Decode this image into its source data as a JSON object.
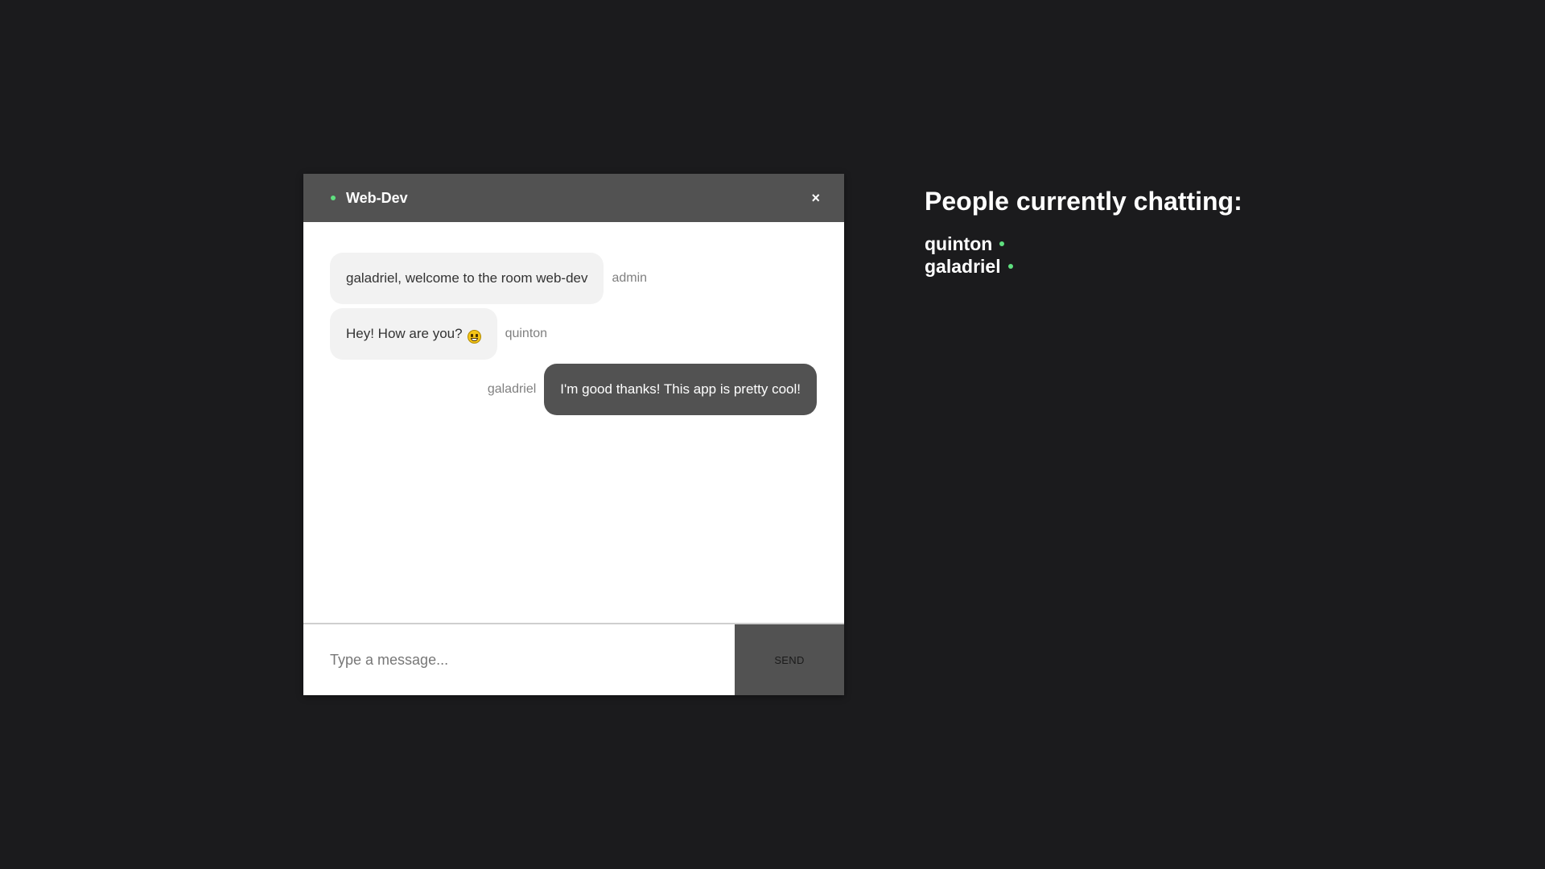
{
  "chat": {
    "room_title": "Web-Dev",
    "close_label": "×",
    "input_placeholder": "Type a message...",
    "send_label": "SEND",
    "messages": [
      {
        "text": "galadriel, welcome to the room web-dev",
        "sender": "admin",
        "direction": "incoming"
      },
      {
        "text": "Hey! How are you?",
        "sender": "quinton",
        "direction": "incoming",
        "emoji": "grinning-face-emoji"
      },
      {
        "text": "I'm good thanks! This app is pretty cool!",
        "sender": "galadriel",
        "direction": "outgoing"
      }
    ]
  },
  "people": {
    "title": "People currently chatting:",
    "users": [
      {
        "name": "quinton",
        "status": "online"
      },
      {
        "name": "galadriel",
        "status": "online"
      }
    ]
  },
  "colors": {
    "background": "#1b1b1d",
    "header": "#525252",
    "online": "#5fe07f",
    "incoming_bubble": "#f2f2f2",
    "outgoing_bubble": "#525252"
  }
}
